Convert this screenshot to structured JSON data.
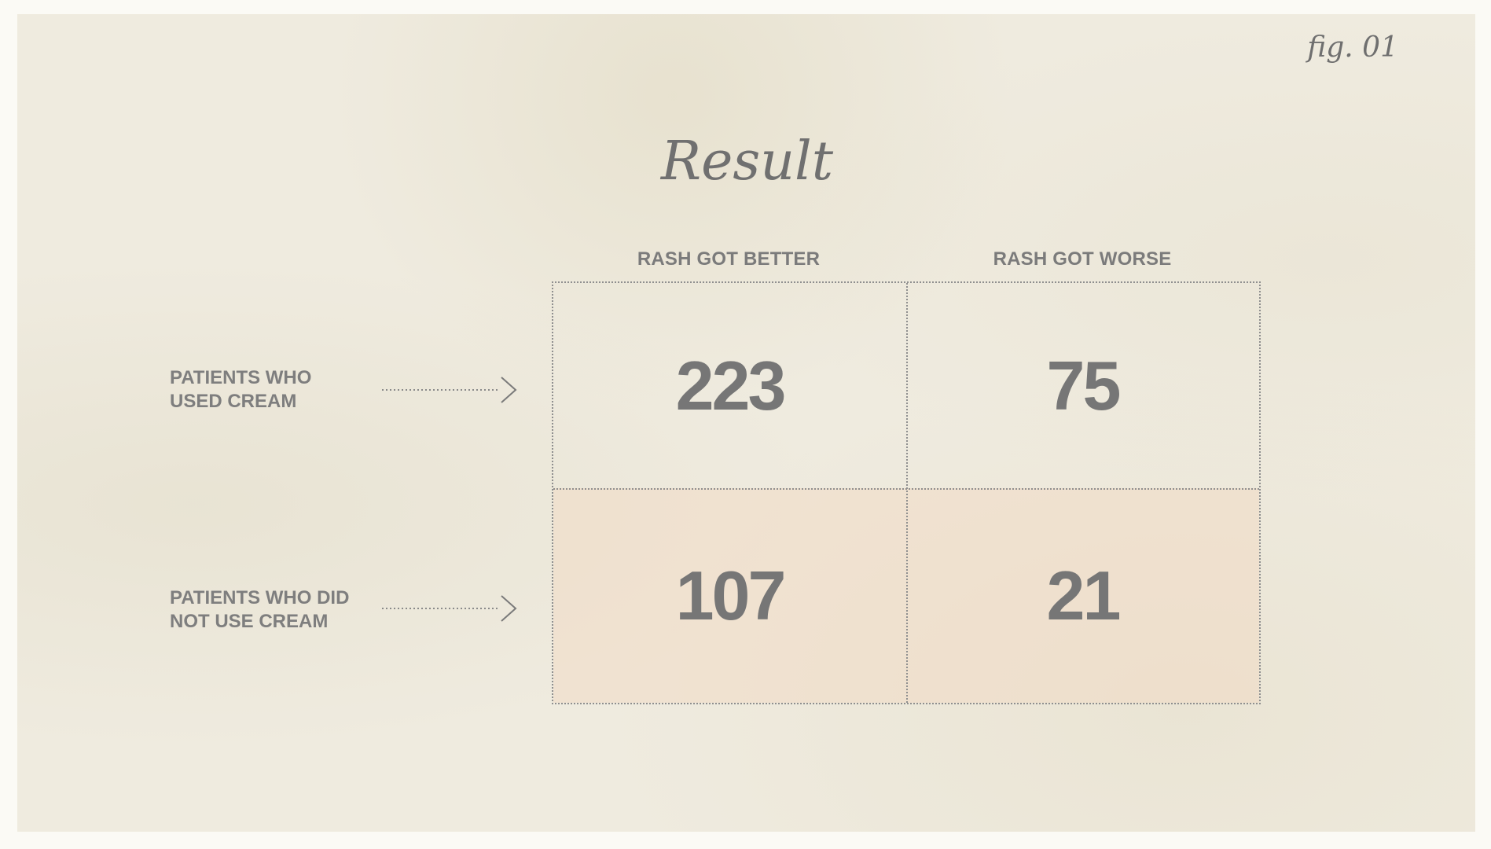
{
  "figure_label": "fig. 01",
  "chart_data": {
    "type": "table",
    "title": "Result",
    "columns": [
      "RASH GOT BETTER",
      "RASH GOT WORSE"
    ],
    "rows": [
      "PATIENTS WHO\nUSED CREAM",
      "PATIENTS WHO DID\nNOT USE CREAM"
    ],
    "values": [
      [
        223,
        75
      ],
      [
        107,
        21
      ]
    ],
    "highlighted_row": 1,
    "colors": {
      "background": "#efebdf",
      "highlight": "#f2dac4",
      "text": "#767676"
    }
  }
}
